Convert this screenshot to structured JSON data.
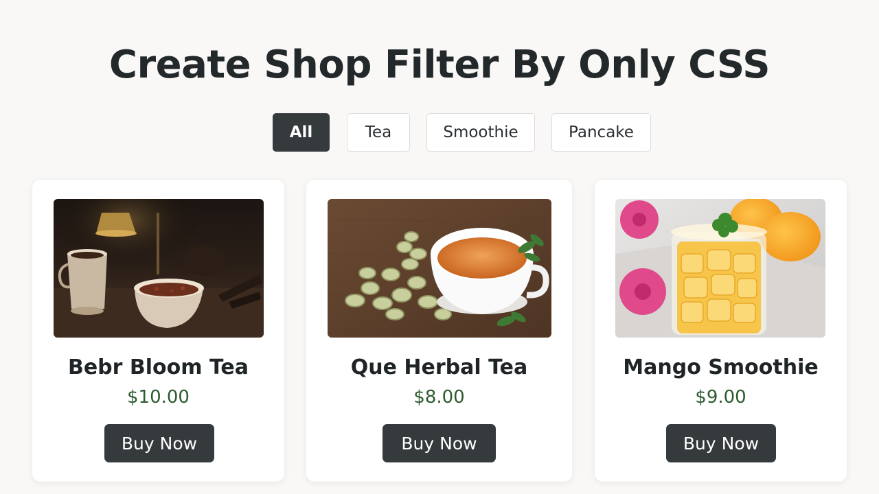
{
  "page": {
    "title": "Create Shop Filter By Only CSS"
  },
  "filters": [
    {
      "label": "All",
      "active": true
    },
    {
      "label": "Tea",
      "active": false
    },
    {
      "label": "Smoothie",
      "active": false
    },
    {
      "label": "Pancake",
      "active": false
    }
  ],
  "products": [
    {
      "name": "Bebr Bloom Tea",
      "price": "$10.00",
      "button": "Buy Now",
      "image": "bloom-tea-photo"
    },
    {
      "name": "Que Herbal Tea",
      "price": "$8.00",
      "button": "Buy Now",
      "image": "herbal-tea-photo"
    },
    {
      "name": "Mango Smoothie",
      "price": "$9.00",
      "button": "Buy Now",
      "image": "mango-smoothie-photo"
    }
  ],
  "colors": {
    "background": "#f9f8f6",
    "dark_button": "#353a3c",
    "price_green": "#2d5a2e",
    "card": "#ffffff"
  }
}
